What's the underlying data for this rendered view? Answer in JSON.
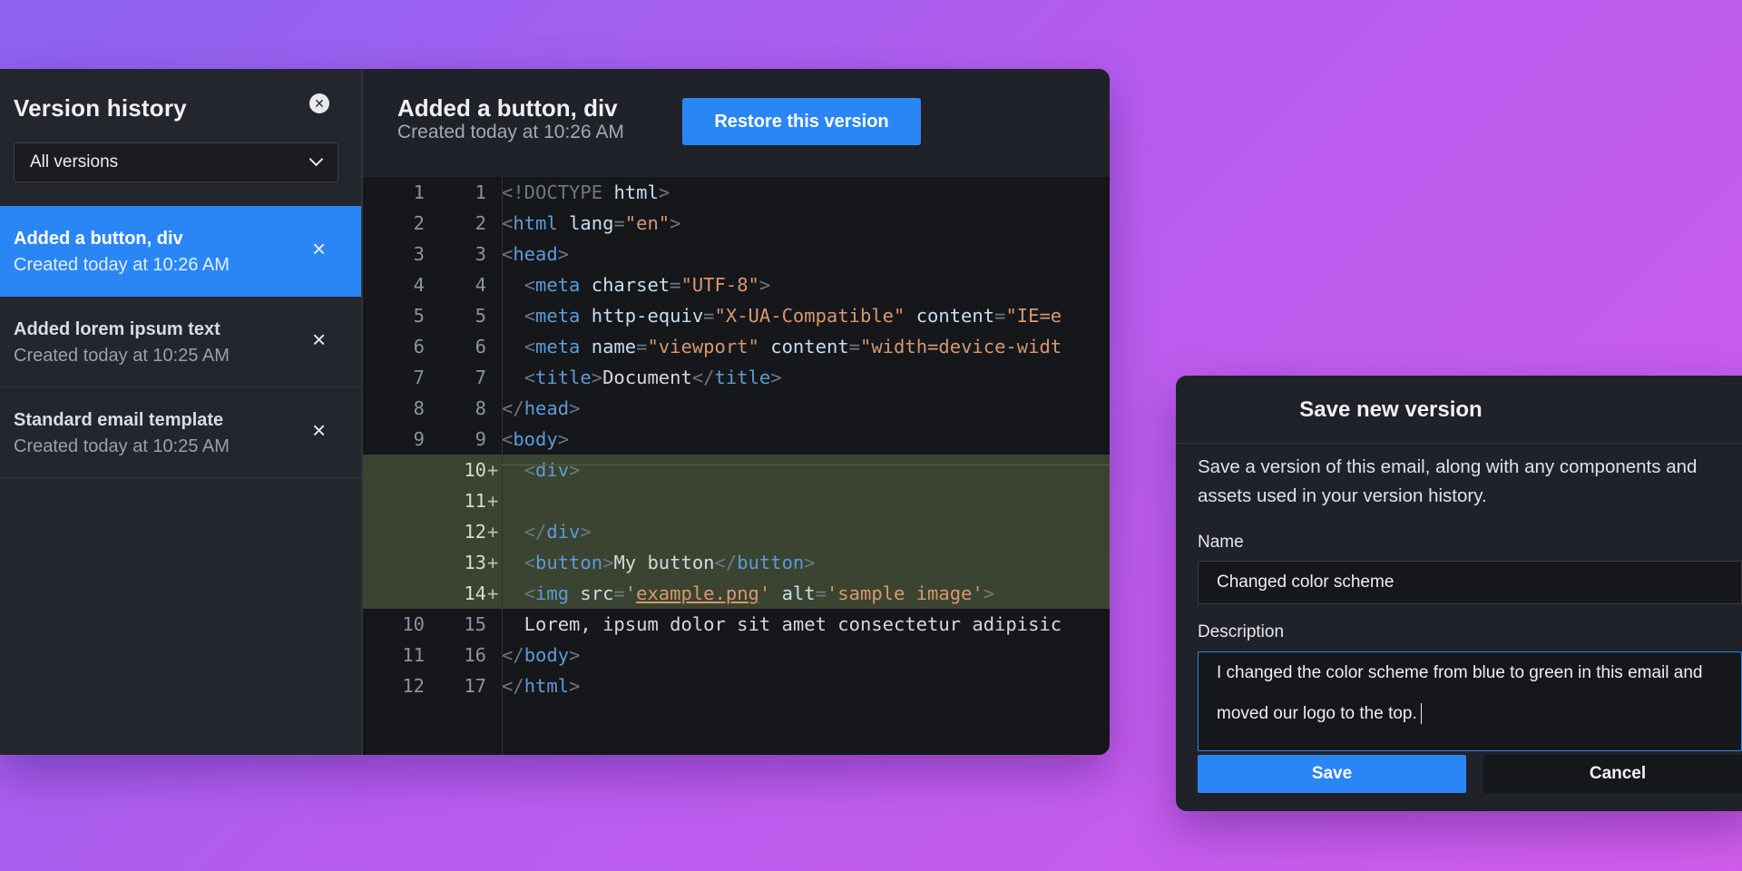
{
  "colors": {
    "accent": "#2a86f5",
    "panel": "#1f2229",
    "code_bg": "#15171b",
    "added_line": "#3a4430"
  },
  "version_history": {
    "title": "Version history",
    "close_icon": "close-circle-icon",
    "close_glyph": "✕",
    "filter": {
      "selected": "All versions",
      "icon": "chevron-down-icon"
    },
    "items": [
      {
        "name": "Added a button, div",
        "date": "Created today at 10:26 AM",
        "active": true,
        "delete_glyph": "×"
      },
      {
        "name": "Added lorem ipsum text",
        "date": "Created today at 10:25 AM",
        "active": false,
        "delete_glyph": "×"
      },
      {
        "name": "Standard email template",
        "date": "Created today at 10:25 AM",
        "active": false,
        "delete_glyph": "×"
      }
    ]
  },
  "preview": {
    "title": "Added a button, div",
    "date": "Created today at 10:26 AM",
    "restore_label": "Restore this version"
  },
  "diff": {
    "lines": [
      {
        "old": "1",
        "new": "1",
        "added": false,
        "tokens": [
          [
            "p",
            "<!DOCTYPE"
          ],
          [
            "x",
            " "
          ],
          [
            "a",
            "html"
          ],
          [
            "p",
            ">"
          ]
        ]
      },
      {
        "old": "2",
        "new": "2",
        "added": false,
        "tokens": [
          [
            "p",
            "<"
          ],
          [
            "t",
            "html"
          ],
          [
            "x",
            " "
          ],
          [
            "a",
            "lang"
          ],
          [
            "p",
            "="
          ],
          [
            "s",
            "\"en\""
          ],
          [
            "p",
            ">"
          ]
        ]
      },
      {
        "old": "3",
        "new": "3",
        "added": false,
        "tokens": [
          [
            "p",
            "<"
          ],
          [
            "t",
            "head"
          ],
          [
            "p",
            ">"
          ]
        ]
      },
      {
        "old": "4",
        "new": "4",
        "added": false,
        "tokens": [
          [
            "x",
            "  "
          ],
          [
            "p",
            "<"
          ],
          [
            "t",
            "meta"
          ],
          [
            "x",
            " "
          ],
          [
            "a",
            "charset"
          ],
          [
            "p",
            "="
          ],
          [
            "s",
            "\"UTF-8\""
          ],
          [
            "p",
            ">"
          ]
        ]
      },
      {
        "old": "5",
        "new": "5",
        "added": false,
        "tokens": [
          [
            "x",
            "  "
          ],
          [
            "p",
            "<"
          ],
          [
            "t",
            "meta"
          ],
          [
            "x",
            " "
          ],
          [
            "a",
            "http-equiv"
          ],
          [
            "p",
            "="
          ],
          [
            "s",
            "\"X-UA-Compatible\""
          ],
          [
            "x",
            " "
          ],
          [
            "a",
            "content"
          ],
          [
            "p",
            "="
          ],
          [
            "s",
            "\"IE=e"
          ]
        ]
      },
      {
        "old": "6",
        "new": "6",
        "added": false,
        "tokens": [
          [
            "x",
            "  "
          ],
          [
            "p",
            "<"
          ],
          [
            "t",
            "meta"
          ],
          [
            "x",
            " "
          ],
          [
            "a",
            "name"
          ],
          [
            "p",
            "="
          ],
          [
            "s",
            "\"viewport\""
          ],
          [
            "x",
            " "
          ],
          [
            "a",
            "content"
          ],
          [
            "p",
            "="
          ],
          [
            "s",
            "\"width=device-widt"
          ]
        ]
      },
      {
        "old": "7",
        "new": "7",
        "added": false,
        "tokens": [
          [
            "x",
            "  "
          ],
          [
            "p",
            "<"
          ],
          [
            "t",
            "title"
          ],
          [
            "p",
            ">"
          ],
          [
            "x",
            "Document"
          ],
          [
            "p",
            "</"
          ],
          [
            "t",
            "title"
          ],
          [
            "p",
            ">"
          ]
        ]
      },
      {
        "old": "8",
        "new": "8",
        "added": false,
        "tokens": [
          [
            "p",
            "</"
          ],
          [
            "t",
            "head"
          ],
          [
            "p",
            ">"
          ]
        ]
      },
      {
        "old": "9",
        "new": "9",
        "added": false,
        "tokens": [
          [
            "p",
            "<"
          ],
          [
            "t",
            "body"
          ],
          [
            "p",
            ">"
          ]
        ]
      },
      {
        "old": "",
        "new": "10",
        "added": true,
        "tokens": [
          [
            "x",
            "  "
          ],
          [
            "p",
            "<"
          ],
          [
            "t",
            "div"
          ],
          [
            "p",
            ">"
          ]
        ]
      },
      {
        "old": "",
        "new": "11",
        "added": true,
        "tokens": []
      },
      {
        "old": "",
        "new": "12",
        "added": true,
        "tokens": [
          [
            "x",
            "  "
          ],
          [
            "p",
            "</"
          ],
          [
            "t",
            "div"
          ],
          [
            "p",
            ">"
          ]
        ]
      },
      {
        "old": "",
        "new": "13",
        "added": true,
        "tokens": [
          [
            "x",
            "  "
          ],
          [
            "p",
            "<"
          ],
          [
            "t",
            "button"
          ],
          [
            "p",
            ">"
          ],
          [
            "x",
            "My button"
          ],
          [
            "p",
            "</"
          ],
          [
            "t",
            "button"
          ],
          [
            "p",
            ">"
          ]
        ]
      },
      {
        "old": "",
        "new": "14",
        "added": true,
        "tokens": [
          [
            "x",
            "  "
          ],
          [
            "p",
            "<"
          ],
          [
            "t",
            "img"
          ],
          [
            "x",
            " "
          ],
          [
            "a",
            "src"
          ],
          [
            "p",
            "="
          ],
          [
            "s",
            "'"
          ],
          [
            "u",
            "example.png"
          ],
          [
            "s",
            "'"
          ],
          [
            "x",
            " "
          ],
          [
            "a",
            "alt"
          ],
          [
            "p",
            "="
          ],
          [
            "s",
            "'sample image'"
          ],
          [
            "p",
            ">"
          ]
        ]
      },
      {
        "old": "10",
        "new": "15",
        "added": false,
        "tokens": [
          [
            "x",
            "  Lorem, ipsum dolor sit amet consectetur adipisic"
          ]
        ]
      },
      {
        "old": "11",
        "new": "16",
        "added": false,
        "tokens": [
          [
            "p",
            "</"
          ],
          [
            "t",
            "body"
          ],
          [
            "p",
            ">"
          ]
        ]
      },
      {
        "old": "12",
        "new": "17",
        "added": false,
        "tokens": [
          [
            "p",
            "</"
          ],
          [
            "t",
            "html"
          ],
          [
            "p",
            ">"
          ]
        ]
      }
    ],
    "plus_glyph": "+"
  },
  "save_dialog": {
    "title": "Save new version",
    "description": "Save a version of this email, along with any components and assets used in your version history.",
    "name_label": "Name",
    "name_value": "Changed color scheme",
    "description_label": "Description",
    "description_value": "I changed the color scheme from blue to green in this email and moved our logo to the top.",
    "save_label": "Save",
    "cancel_label": "Cancel"
  }
}
